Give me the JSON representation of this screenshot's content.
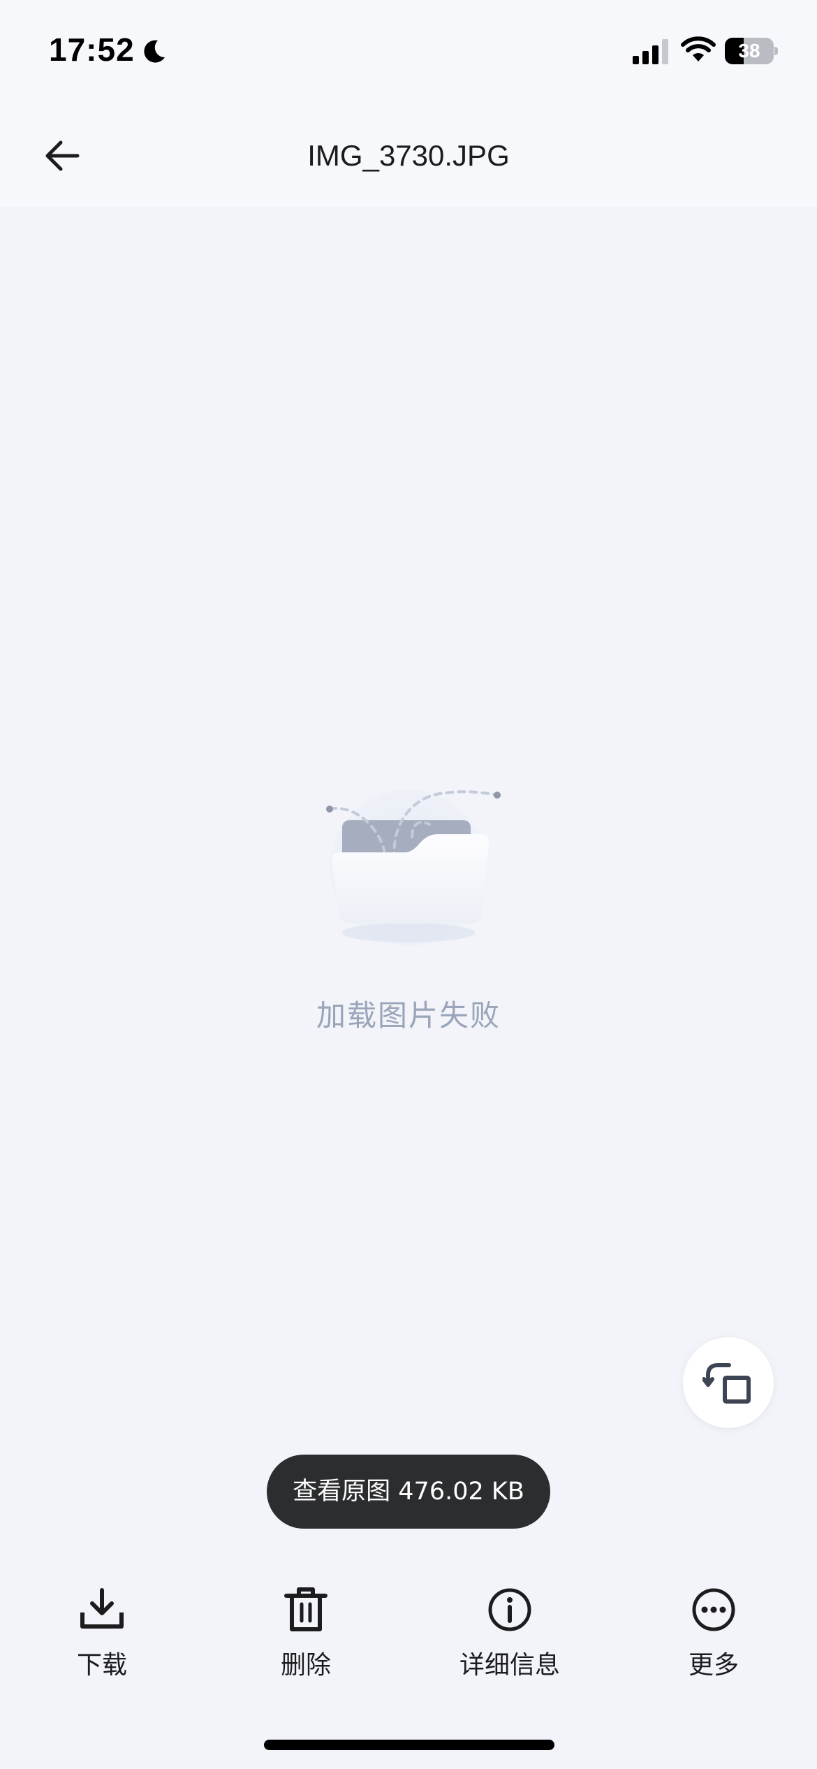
{
  "status_bar": {
    "time": "17:52",
    "battery_level": "38",
    "icons": [
      "moon-icon",
      "cellular-signal-icon",
      "wifi-icon",
      "battery-icon"
    ]
  },
  "nav": {
    "title": "IMG_3730.JPG",
    "back_icon": "arrow-left-icon"
  },
  "content": {
    "error_message": "加载图片失败",
    "illustration_icon": "empty-folder-icon",
    "rotate_icon": "rotate-icon"
  },
  "view_original": {
    "label": "查看原图 476.02 KB"
  },
  "toolbar": {
    "items": [
      {
        "label": "下载",
        "icon": "download-icon"
      },
      {
        "label": "删除",
        "icon": "trash-icon"
      },
      {
        "label": "详细信息",
        "icon": "info-icon"
      },
      {
        "label": "更多",
        "icon": "more-icon"
      }
    ]
  },
  "colors": {
    "background": "#f2f4f9",
    "bar_background": "#f7f8fb",
    "error_text": "#9aa5ba",
    "pill_background": "#2c2d2f",
    "icon_dark": "#1c1c1e"
  }
}
